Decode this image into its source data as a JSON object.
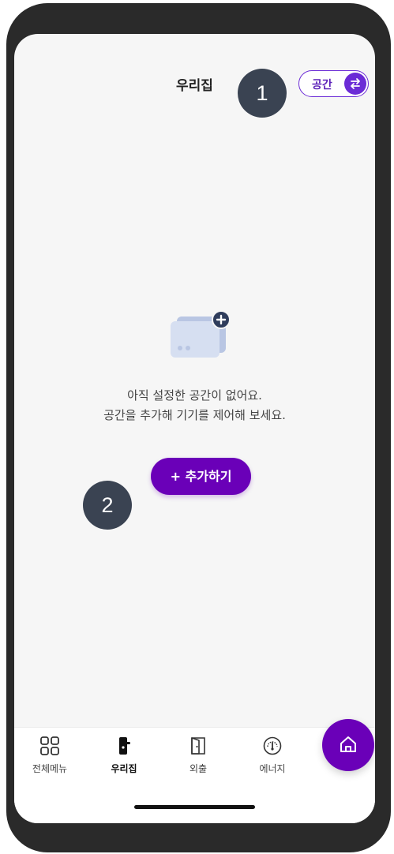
{
  "header": {
    "title": "우리집",
    "space_toggle_label": "공간"
  },
  "markers": {
    "one": "1",
    "two": "2"
  },
  "empty_state": {
    "line1": "아직 설정한 공간이 없어요.",
    "line2": "공간을 추가해 기기를 제어해 보세요."
  },
  "add_button_label": "+ 추가하기",
  "nav": {
    "all_menu": "전체메뉴",
    "home": "우리집",
    "away": "외출",
    "energy": "에너지"
  },
  "colors": {
    "accent": "#6a00b8",
    "marker": "#3a4352",
    "illustration_badge": "#2f3d5c"
  },
  "icons": {
    "swap": "swap-arrows-icon",
    "all_menu": "grid-icon",
    "home": "door-lock-icon",
    "away": "door-icon",
    "energy": "gauge-icon",
    "fab": "home-icon"
  }
}
